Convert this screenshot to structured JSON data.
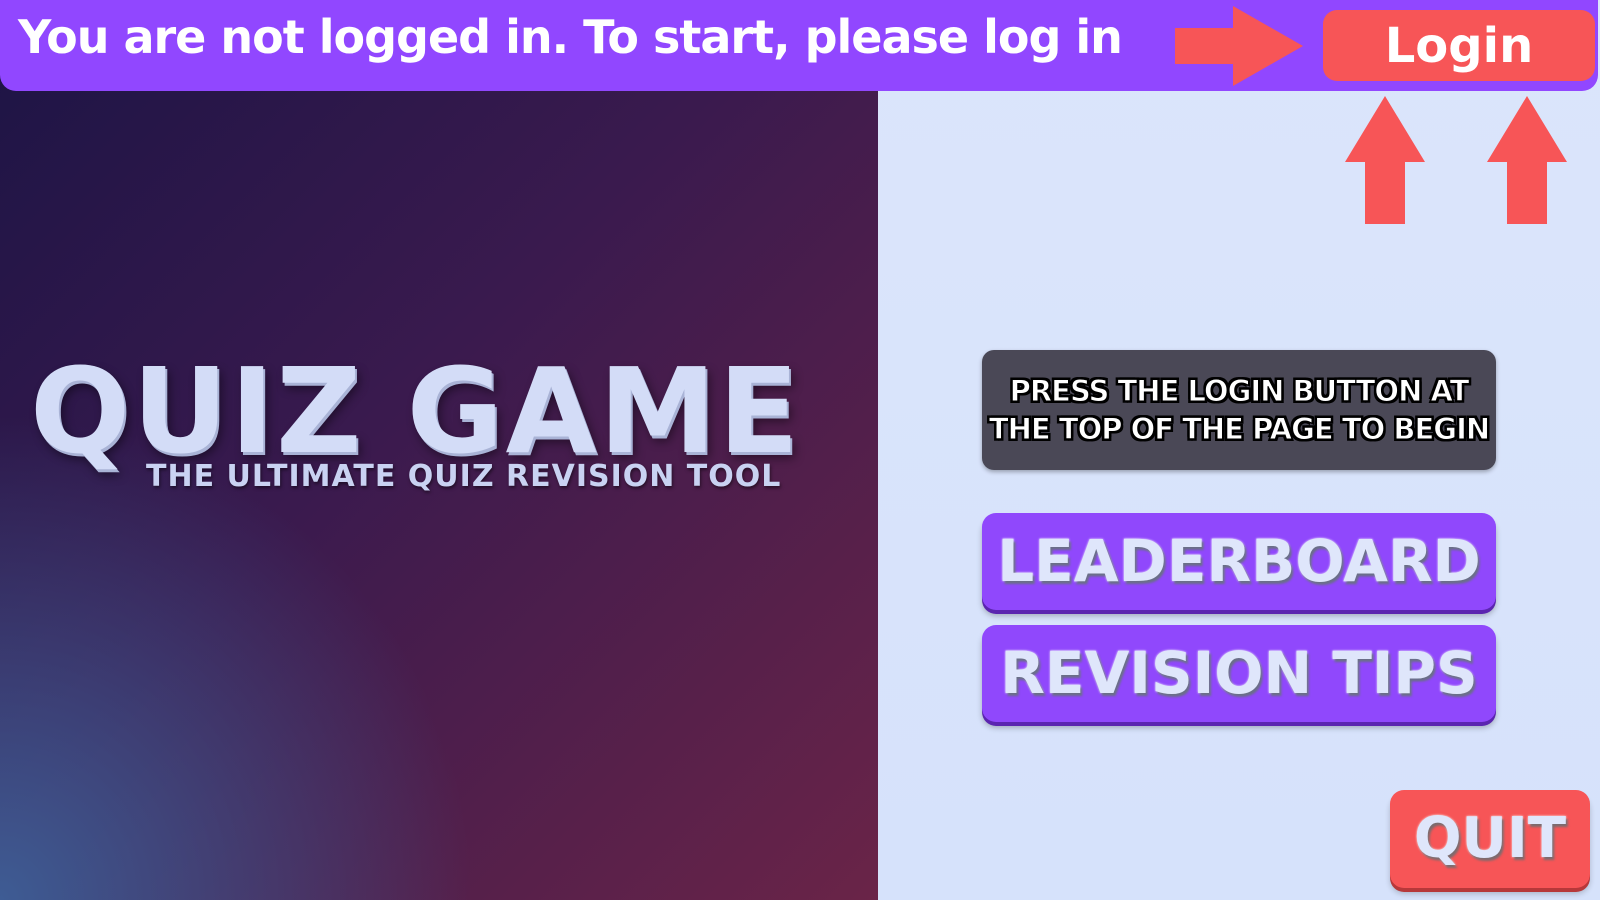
{
  "topbar": {
    "message": "You are not logged in. To start, please log in",
    "login_label": "Login"
  },
  "hero": {
    "title": "QUIZ GAME",
    "subtitle": "THE ULTIMATE QUIZ REVISION TOOL"
  },
  "info": {
    "text": "PRESS THE LOGIN BUTTON AT\nTHE TOP OF THE PAGE TO BEGIN"
  },
  "menu": {
    "leaderboard_label": "LEADERBOARD",
    "revision_tips_label": "REVISION TIPS",
    "quit_label": "QUIT"
  },
  "icons": {
    "arrow_right": "arrow-right-icon",
    "arrow_up": "arrow-up-icon"
  },
  "colors": {
    "accent_purple": "#9147ff",
    "accent_red": "#f75557",
    "panel_dark": "#4a4856",
    "right_bg": "#d7e3fb"
  }
}
